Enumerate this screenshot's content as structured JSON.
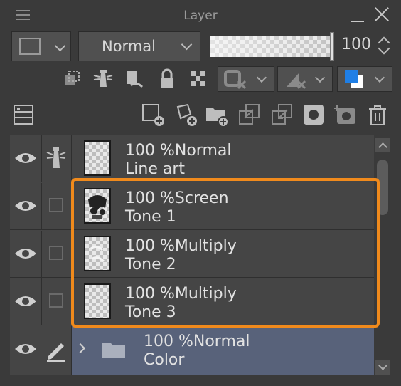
{
  "window": {
    "title": "Layer"
  },
  "palette": {
    "accent": "#f08a1c",
    "selected_row": "#58627a",
    "panel_bg": "#3a3a3a",
    "list_bg": "#454545"
  },
  "properties": {
    "blend_mode": "Normal",
    "opacity": "100"
  },
  "layers": [
    {
      "opacity_mode": "100 %Normal",
      "name": "Line art",
      "state": "lighthouse-icon",
      "selected": false
    },
    {
      "opacity_mode": "100 %Screen",
      "name": "Tone 1",
      "state": "checkbox",
      "selected": false
    },
    {
      "opacity_mode": "100 %Multiply",
      "name": "Tone 2",
      "state": "checkbox",
      "selected": false
    },
    {
      "opacity_mode": "100 %Multiply",
      "name": "Tone 3",
      "state": "checkbox",
      "selected": false
    },
    {
      "opacity_mode": "100 %Normal",
      "name": "Color",
      "state": "pen-icon",
      "selected": true,
      "type": "folder"
    }
  ]
}
